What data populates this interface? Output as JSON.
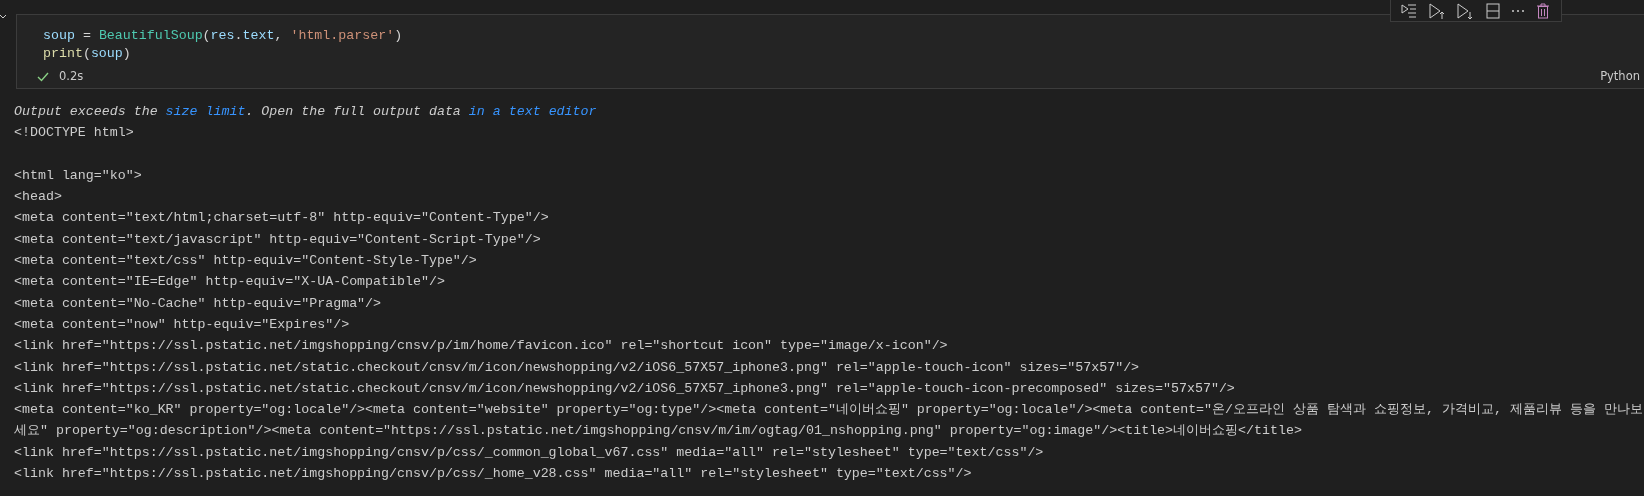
{
  "cell_toolbar": {
    "buttons": [
      {
        "kind": "run-by-line"
      },
      {
        "kind": "run-above"
      },
      {
        "kind": "run-below"
      },
      {
        "kind": "split"
      },
      {
        "kind": "more"
      },
      {
        "kind": "delete"
      }
    ]
  },
  "cell": {
    "code_lines": [
      [
        {
          "text": "soup",
          "kind": "variable"
        },
        {
          "text": " = ",
          "kind": "plain"
        },
        {
          "text": "BeautifulSoup",
          "kind": "class"
        },
        {
          "text": "(",
          "kind": "plain"
        },
        {
          "text": "res",
          "kind": "variable"
        },
        {
          "text": ".",
          "kind": "plain"
        },
        {
          "text": "text",
          "kind": "variable"
        },
        {
          "text": ", ",
          "kind": "plain"
        },
        {
          "text": "'html.parser'",
          "kind": "string"
        },
        {
          "text": ")",
          "kind": "plain"
        }
      ],
      [
        {
          "text": "print",
          "kind": "function"
        },
        {
          "text": "(",
          "kind": "plain"
        },
        {
          "text": "soup",
          "kind": "variable"
        },
        {
          "text": ")",
          "kind": "plain"
        }
      ]
    ],
    "status": {
      "success": true,
      "duration": "0.2s"
    },
    "language": "Python"
  },
  "output": {
    "notice": [
      {
        "text": "Output exceeds the ",
        "kind": "text"
      },
      {
        "text": "size limit",
        "kind": "link"
      },
      {
        "text": ". Open the full output data ",
        "kind": "text"
      },
      {
        "text": "in a text editor",
        "kind": "link"
      }
    ],
    "lines": [
      {
        "kind": "text",
        "text": "<!DOCTYPE html>"
      },
      {
        "kind": "blank"
      },
      {
        "kind": "text",
        "text": "<html lang=\"ko\">"
      },
      {
        "kind": "text",
        "text": "<head>"
      },
      {
        "kind": "text",
        "text": "<meta content=\"text/html;charset=utf-8\" http-equiv=\"Content-Type\"/>"
      },
      {
        "kind": "text",
        "text": "<meta content=\"text/javascript\" http-equiv=\"Content-Script-Type\"/>"
      },
      {
        "kind": "text",
        "text": "<meta content=\"text/css\" http-equiv=\"Content-Style-Type\"/>"
      },
      {
        "kind": "text",
        "text": "<meta content=\"IE=Edge\" http-equiv=\"X-UA-Compatible\"/>"
      },
      {
        "kind": "text",
        "text": "<meta content=\"No-Cache\" http-equiv=\"Pragma\"/>"
      },
      {
        "kind": "text",
        "text": "<meta content=\"now\" http-equiv=\"Expires\"/>"
      },
      {
        "kind": "text",
        "text": "<link href=\"https://ssl.pstatic.net/imgshopping/cnsv/p/im/home/favicon.ico\" rel=\"shortcut icon\" type=\"image/x-icon\"/>"
      },
      {
        "kind": "text",
        "text": "<link href=\"https://ssl.pstatic.net/static.checkout/cnsv/m/icon/newshopping/v2/iOS6_57X57_iphone3.png\" rel=\"apple-touch-icon\" sizes=\"57x57\"/>"
      },
      {
        "kind": "text",
        "text": "<link href=\"https://ssl.pstatic.net/static.checkout/cnsv/m/icon/newshopping/v2/iOS6_57X57_iphone3.png\" rel=\"apple-touch-icon-precomposed\" sizes=\"57x57\"/>"
      },
      {
        "kind": "text",
        "text": "<meta content=\"ko_KR\" property=\"og:locale\"/><meta content=\"website\" property=\"og:type\"/><meta content=\"네이버쇼핑\" property=\"og:locale\"/><meta content=\"온/오프라인 상품 탐색과 쇼핑정보, 가격비교, 제품리뷰 등을 만나보"
      },
      {
        "kind": "text",
        "text": "세요\" property=\"og:description\"/><meta content=\"https://ssl.pstatic.net/imgshopping/cnsv/m/im/ogtag/01_nshopping.png\" property=\"og:image\"/><title>네이버쇼핑</title>"
      },
      {
        "kind": "text",
        "text": "<link href=\"https://ssl.pstatic.net/imgshopping/cnsv/p/css/_common_global_v67.css\" media=\"all\" rel=\"stylesheet\" type=\"text/css\"/>"
      },
      {
        "kind": "text",
        "text": "<link href=\"https://ssl.pstatic.net/imgshopping/cnsv/p/css/_home_v28.css\" media=\"all\" rel=\"stylesheet\" type=\"text/css\"/>"
      }
    ]
  }
}
